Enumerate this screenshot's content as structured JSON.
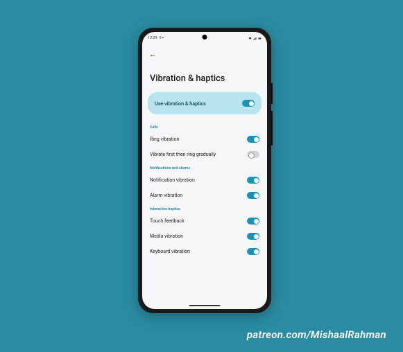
{
  "status": {
    "time": "12:29",
    "icons": "▾ ◆ ▪"
  },
  "page": {
    "title": "Vibration & haptics"
  },
  "hero": {
    "label": "Use vibration & haptics",
    "enabled": true
  },
  "sections": [
    {
      "header": "Calls",
      "items": [
        {
          "label": "Ring vibration",
          "enabled": true
        },
        {
          "label": "Vibrate first then ring gradually",
          "enabled": false
        }
      ]
    },
    {
      "header": "Notifications and alarms",
      "items": [
        {
          "label": "Notification vibration",
          "enabled": true
        },
        {
          "label": "Alarm vibration",
          "enabled": true
        }
      ]
    },
    {
      "header": "Interactive haptics",
      "items": [
        {
          "label": "Touch feedback",
          "enabled": true
        },
        {
          "label": "Media vibration",
          "enabled": true
        },
        {
          "label": "Keyboard vibration",
          "enabled": true
        }
      ]
    }
  ],
  "credit": "patreon.com/MishaalRahman"
}
